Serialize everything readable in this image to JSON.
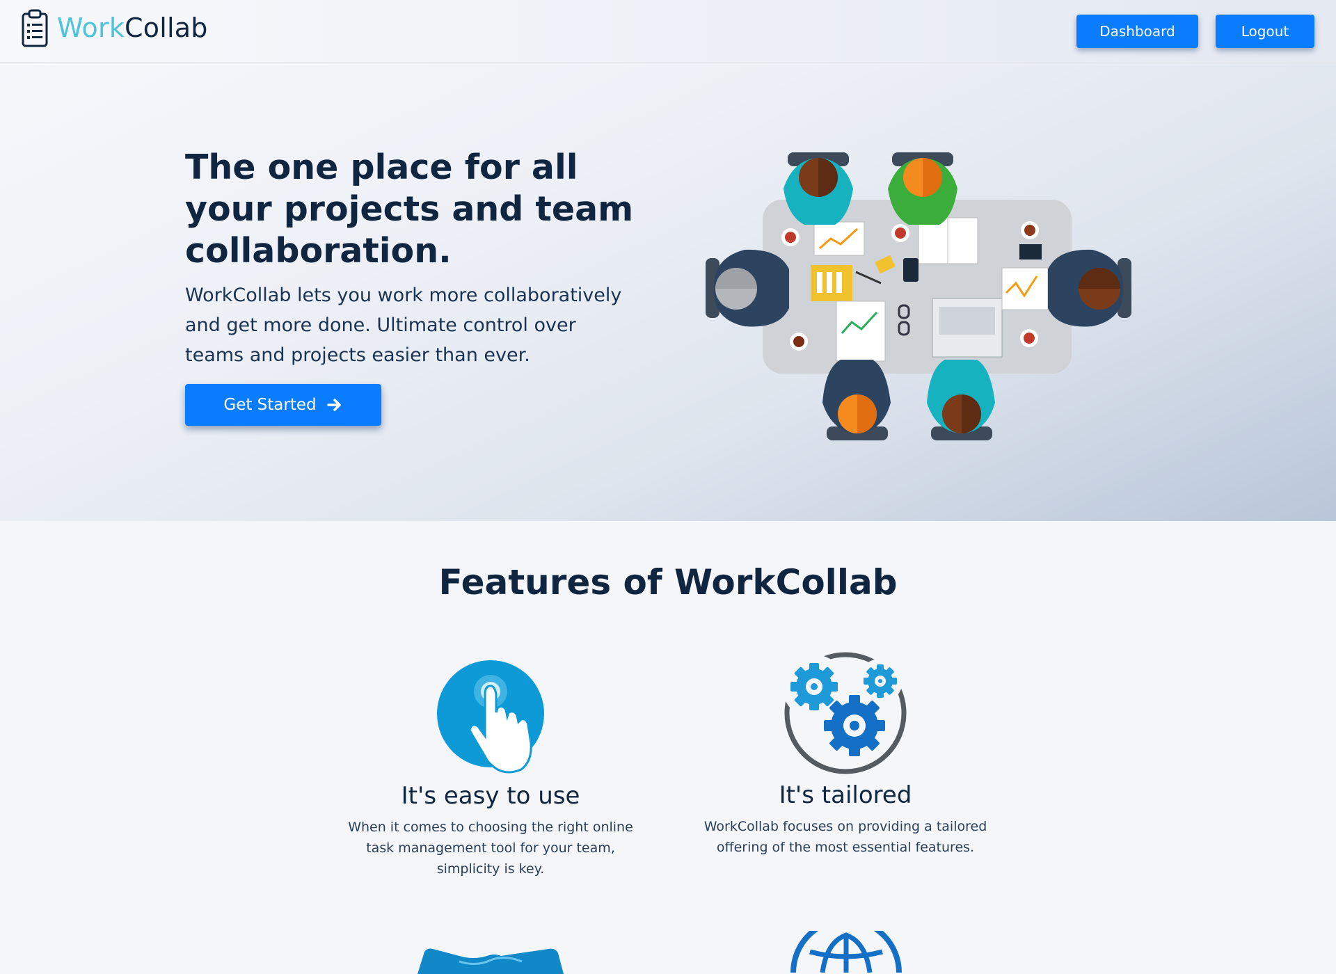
{
  "navbar": {
    "brand_part1": "Work",
    "brand_part2": "Collab",
    "logo_icon": "clipboard-list-icon",
    "dashboard_label": "Dashboard",
    "logout_label": "Logout"
  },
  "hero": {
    "title": "The one place for all your projects and team collaboration.",
    "subtitle": "WorkCollab lets you work more collaboratively and get more done. Ultimate control over teams and projects easier than ever.",
    "cta_label": "Get Started",
    "cta_icon": "arrow-right-icon",
    "illustration": "team-meeting-table-illustration"
  },
  "features": {
    "title": "Features of WorkCollab",
    "items": [
      {
        "icon": "tap-hand-icon",
        "title": "It's easy to use",
        "description": "When it comes to choosing the right online task management tool for your team, simplicity is key."
      },
      {
        "icon": "gears-icon",
        "title": "It's tailored",
        "description": "WorkCollab focuses on providing a tailored offering of the most essential features."
      },
      {
        "icon": "handshake-icon"
      },
      {
        "icon": "globe-icon"
      }
    ]
  },
  "colors": {
    "primary": "#0a7cff",
    "brand_accent": "#4fc3d9",
    "heading": "#0f2540",
    "icon_blue": "#0d86c9"
  }
}
